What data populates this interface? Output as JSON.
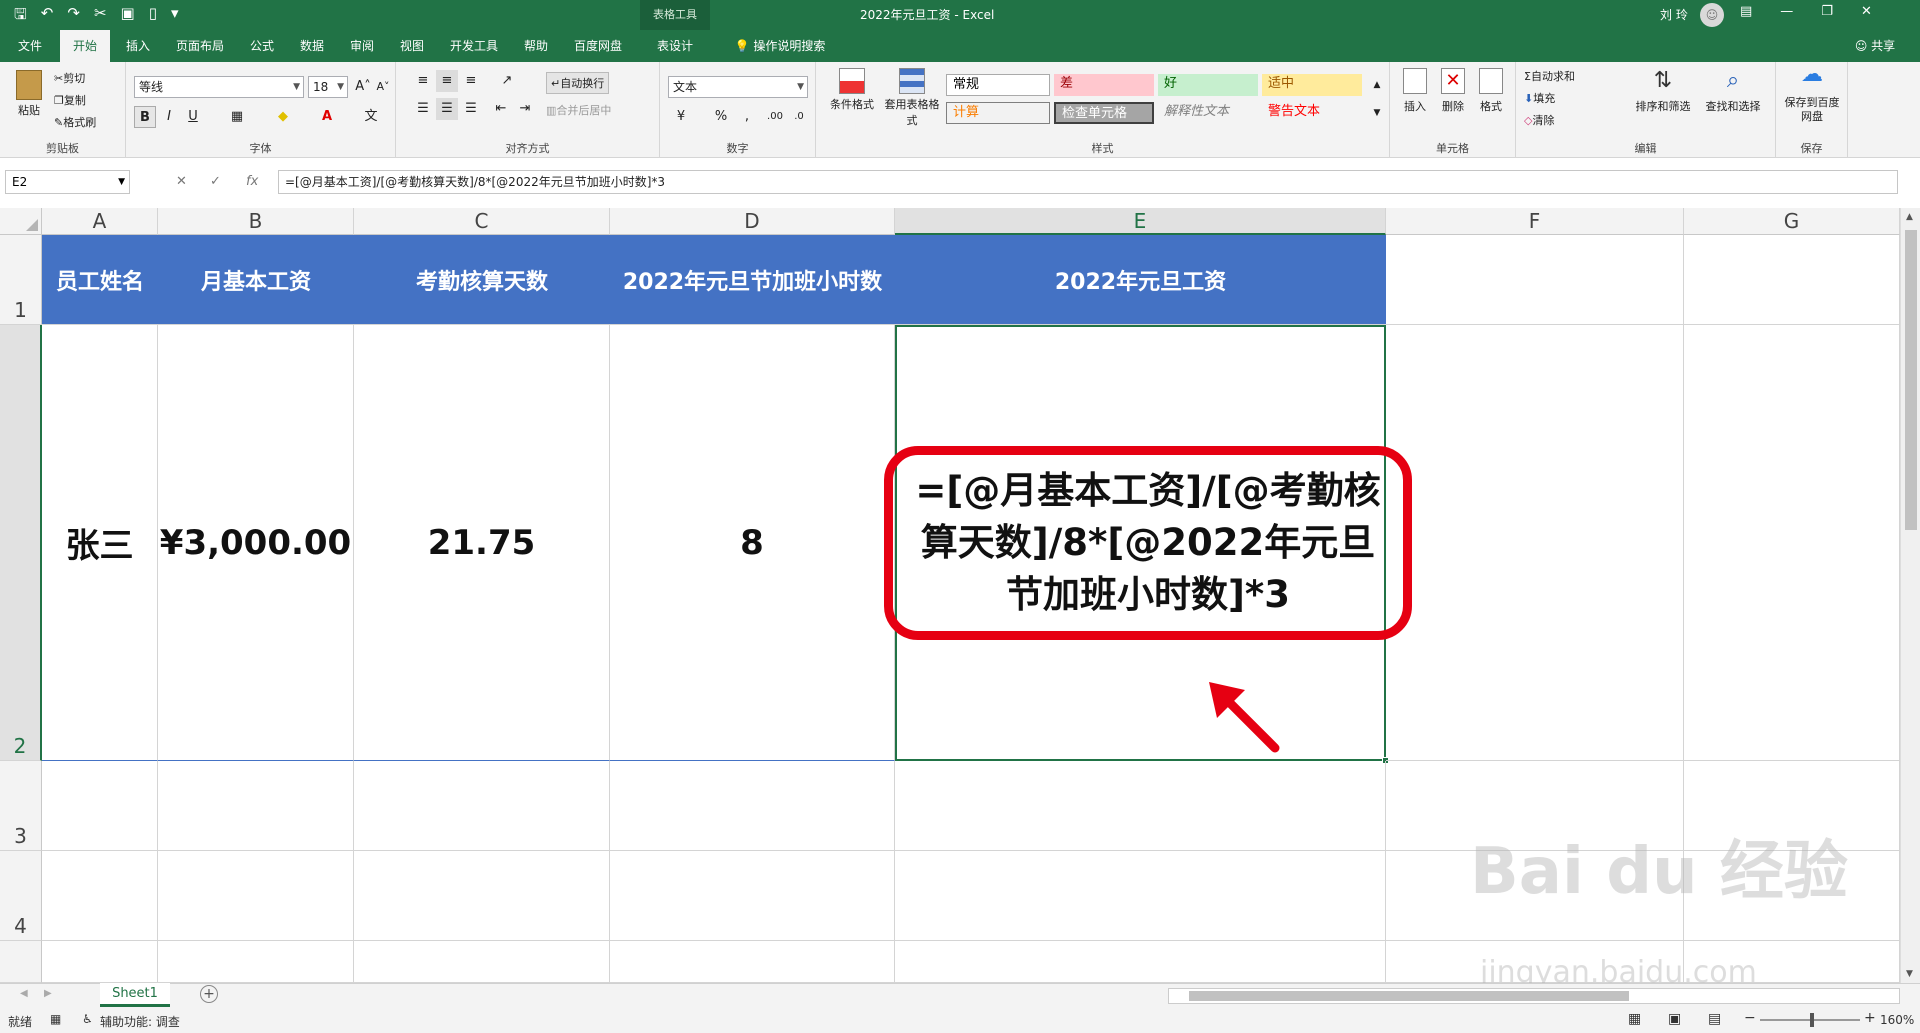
{
  "window": {
    "title": "2022年元旦工资  -  Excel",
    "context_tab": "表格工具",
    "user": "刘 玲",
    "share": "共享"
  },
  "tabs": [
    "文件",
    "开始",
    "插入",
    "页面布局",
    "公式",
    "数据",
    "审阅",
    "视图",
    "开发工具",
    "帮助",
    "百度网盘",
    "表设计",
    "操作说明搜索"
  ],
  "ribbon": {
    "clipboard": {
      "paste": "粘贴",
      "cut": "剪切",
      "copy": "复制",
      "format_painter": "格式刷",
      "label": "剪贴板"
    },
    "font": {
      "name": "等线",
      "size": "18",
      "label": "字体"
    },
    "alignment": {
      "wrap": "自动换行",
      "merge": "合并后居中",
      "label": "对齐方式"
    },
    "number": {
      "format": "文本",
      "label": "数字"
    },
    "styles": {
      "conditional": "条件格式",
      "table_format": "套用表格格式",
      "normal": "常规",
      "bad": "差",
      "good": "好",
      "neutral": "适中",
      "calc": "计算",
      "check": "检查单元格",
      "explanatory": "解释性文本",
      "warning": "警告文本",
      "label": "样式"
    },
    "cells": {
      "insert": "插入",
      "delete": "删除",
      "format": "格式",
      "label": "单元格"
    },
    "editing": {
      "autosum": "自动求和",
      "fill": "填充",
      "clear": "清除",
      "sort": "排序和筛选",
      "find": "查找和选择",
      "label": "编辑"
    },
    "save": {
      "button": "保存到百度网盘",
      "label": "保存"
    }
  },
  "formula_bar": {
    "name_box": "E2",
    "formula": "=[@月基本工资]/[@考勤核算天数]/8*[@2022年元旦节加班小时数]*3"
  },
  "columns": [
    "A",
    "B",
    "C",
    "D",
    "E",
    "F",
    "G"
  ],
  "rows": [
    "1",
    "2",
    "3",
    "4"
  ],
  "header_row": [
    "员工姓名",
    "月基本工资",
    "考勤核算天数",
    "2022年元旦节加班小时数",
    "2022年元旦工资"
  ],
  "data_row": [
    "张三",
    "¥3,000.00",
    "21.75",
    "8"
  ],
  "callout_text": "=[@月基本工资]/[@考勤核算天数]/8*[@2022年元旦节加班小时数]*3",
  "sheet_tab": "Sheet1",
  "status": {
    "ready": "就绪",
    "accessibility": "辅助功能: 调查",
    "zoom": "160%"
  },
  "watermark": {
    "brand": "Bai du 经验",
    "url": "jingyan.baidu.com"
  }
}
